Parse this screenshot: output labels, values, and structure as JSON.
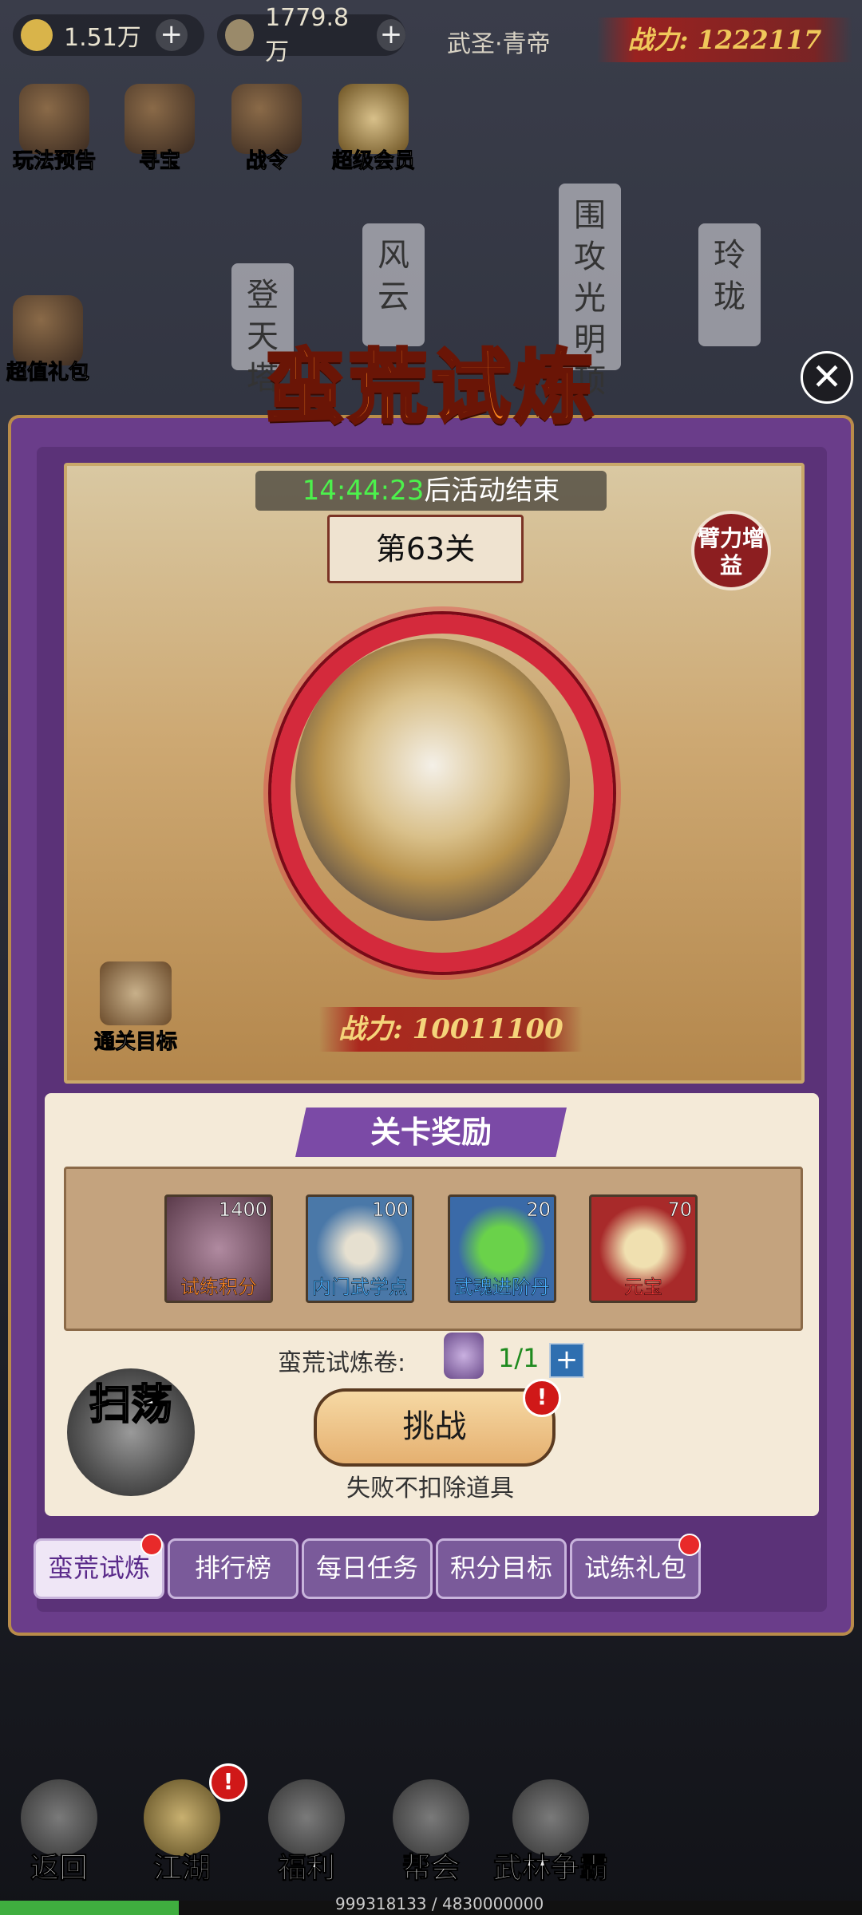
{
  "topbar": {
    "gold": "1.51万",
    "coins": "1779.8万",
    "title": "武圣·青帝",
    "power": "战力: 1222117",
    "plus": "+"
  },
  "top_icons": [
    "玩法预告",
    "寻宝",
    "战令",
    "超级会员"
  ],
  "side_gift": "超值礼包",
  "towers": [
    "登天塔",
    "风云",
    "围攻光明顶",
    "玲珑"
  ],
  "event": {
    "title": "蛮荒试炼",
    "close": "✕",
    "timer_time": "14:44:23",
    "timer_text": "后活动结束",
    "stage": "第63关",
    "buff": "臂力增益",
    "goal": "通关目标",
    "enemy_power": "战力: 10011100"
  },
  "rewards": {
    "title": "关卡奖励",
    "items": [
      {
        "count": "1400",
        "name": "试练积分",
        "color": "#ff8a2a"
      },
      {
        "count": "100",
        "name": "内门武学点",
        "color": "#4ab0ff"
      },
      {
        "count": "20",
        "name": "武魂进阶丹",
        "color": "#4ab0ff"
      },
      {
        "count": "70",
        "name": "元宝",
        "color": "#ff3a3a"
      }
    ]
  },
  "ticket": {
    "label": "蛮荒试炼卷:",
    "count": "1/1",
    "plus": "+"
  },
  "challenge": {
    "label": "挑战",
    "alert": "!",
    "note": "失败不扣除道具"
  },
  "sweep": "扫荡",
  "tabs": [
    "蛮荒试炼",
    "排行榜",
    "每日任务",
    "积分目标",
    "试练礼包"
  ],
  "bottom_nav": [
    "返回",
    "江湖",
    "福利",
    "帮会",
    "武林争霸"
  ],
  "bottom_alert": "!",
  "exp": {
    "text": "999318133 / 4830000000",
    "fraction": 0.207
  }
}
